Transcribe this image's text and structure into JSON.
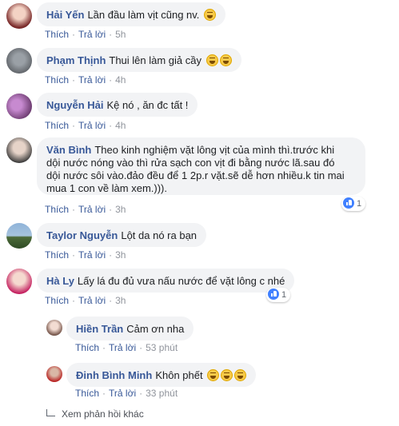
{
  "comments": [
    {
      "name": "Hải Yến",
      "text": "Lần đầu làm vịt cũng nv.",
      "emoji_count": 1,
      "like": "Thích",
      "reply": "Trả lời",
      "time": "5h"
    },
    {
      "name": "Phạm Thịnh",
      "text": "Thui lên làm giả cầy",
      "emoji_count": 2,
      "like": "Thích",
      "reply": "Trả lời",
      "time": "4h"
    },
    {
      "name": "Nguyễn Hải",
      "text": "Kệ nó , ăn đc tất !",
      "emoji_count": 0,
      "like": "Thích",
      "reply": "Trả lời",
      "time": "4h"
    },
    {
      "name": "Văn Bình",
      "text": "Theo kinh nghiệm vặt lông vịt của mình thì.trước khi dội nước nóng vào thì rửa sạch con vịt đi bằng nước lã.sau đó dội nước sôi vào.đảo đều để 1 2p.r vặt.sẽ dễ hơn nhiều.k tin mai mua 1 con về làm xem.))).",
      "emoji_count": 0,
      "like": "Thích",
      "reply": "Trả lời",
      "time": "3h",
      "reactions": "1"
    },
    {
      "name": "Taylor Nguyễn",
      "text": "Lột da nó ra bạn",
      "emoji_count": 0,
      "like": "Thích",
      "reply": "Trả lời",
      "time": "3h"
    },
    {
      "name": "Hà Ly",
      "text": "Lấy lá đu đủ vưa nấu nước để vặt lông c nhé",
      "emoji_count": 0,
      "like": "Thích",
      "reply": "Trả lời",
      "time": "3h",
      "reactions": "1"
    }
  ],
  "replies": [
    {
      "name": "Hiền Trần",
      "text": "Cảm ơn nha",
      "emoji_count": 0,
      "like": "Thích",
      "reply": "Trả lời",
      "time": "53 phút"
    },
    {
      "name": "Đinh Bình Minh",
      "text": "Khôn phết",
      "emoji_count": 3,
      "like": "Thích",
      "reply": "Trả lời",
      "time": "33 phút"
    }
  ],
  "more_replies": "Xem phản hồi khác",
  "colors": {
    "name": "#385898",
    "bubble": "#f2f3f5",
    "like_blue": "#4080ff"
  }
}
